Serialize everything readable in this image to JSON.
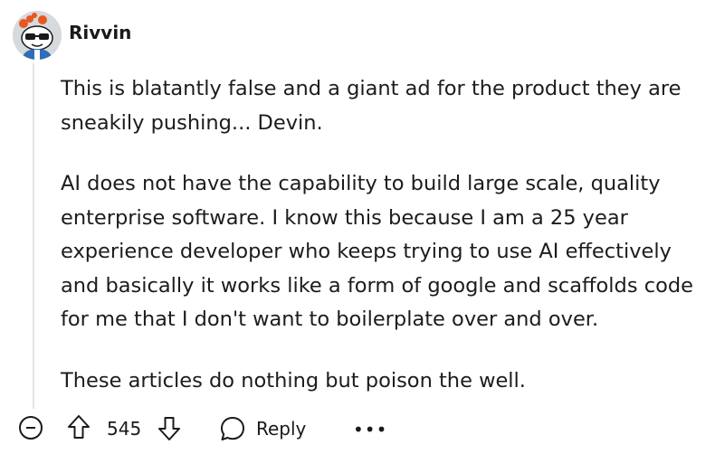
{
  "author": {
    "username": "Rivvin",
    "avatar_icon": "snoo-avatar-icon"
  },
  "comment": {
    "paragraphs": [
      "This is blatantly false and a giant ad for the product they are sneakily pushing... Devin.",
      "AI does not have the capability to build large scale, quality enterprise software. I know this because I am a 25 year experience developer who keeps trying to use AI effectively and basically it works like a form of google and scaffolds code for me that I don't want to boilerplate over and over.",
      "These articles do nothing but poison the well."
    ]
  },
  "actions": {
    "collapse_icon": "collapse-icon",
    "upvote_icon": "upvote-icon",
    "score": "545",
    "downvote_icon": "downvote-icon",
    "reply_icon": "comment-bubble-icon",
    "reply_label": "Reply",
    "more_label": "•••"
  },
  "colors": {
    "text": "#1a1a1b",
    "thread_line": "#e2e5e8",
    "avatar_bg": "#d7dadc"
  }
}
